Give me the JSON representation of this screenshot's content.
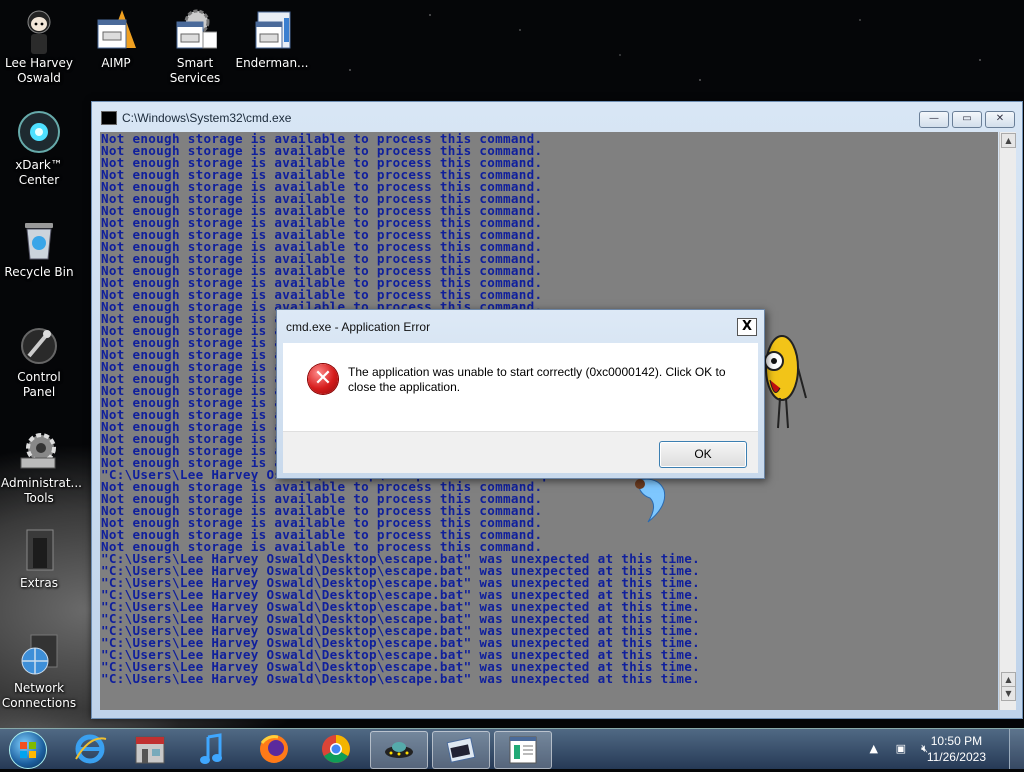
{
  "desktop": {
    "icons": [
      {
        "label": "Lee Harvey Oswald"
      },
      {
        "label": "AIMP"
      },
      {
        "label": "Smart Services"
      },
      {
        "label": "Enderman..."
      },
      {
        "label": "xDark™ Center"
      },
      {
        "label": "Recycle Bin"
      },
      {
        "label": "Control Panel"
      },
      {
        "label": "Administrat... Tools"
      },
      {
        "label": "Extras"
      },
      {
        "label": "Network Connections"
      }
    ]
  },
  "cmd_window": {
    "title": "C:\\Windows\\System32\\cmd.exe",
    "minimize_label": "—",
    "maximize_label": "▭",
    "close_label": "✕",
    "console_lines": [
      "Not enough storage is available to process this command.",
      "Not enough storage is available to process this command.",
      "Not enough storage is available to process this command.",
      "Not enough storage is available to process this command.",
      "Not enough storage is available to process this command.",
      "Not enough storage is available to process this command.",
      "Not enough storage is available to process this command.",
      "Not enough storage is available to process this command.",
      "Not enough storage is available to process this command.",
      "Not enough storage is available to process this command.",
      "Not enough storage is available to process this command.",
      "Not enough storage is available to process this command.",
      "Not enough storage is available to process this command.",
      "Not enough storage is available to process this command.",
      "Not enough storage is available to process this command.",
      "Not enough storage is available to process this command.",
      "Not enough storage is available to process this command.",
      "Not enough storage is available to process this command.",
      "Not enough storage is available to process this command.",
      "Not enough storage is available to process this command.",
      "Not enough storage is available to process this command.",
      "Not enough storage is available to process this command.",
      "Not enough storage is available to process this command.",
      "Not enough storage is available to process this command.",
      "Not enough storage is available to process this command.",
      "Not enough storage is available to process this command.",
      "Not enough storage is available to process this command.",
      "Not enough storage is available to process this command.",
      "\"C:\\Users\\Lee Harvey Oswald\\Desktop\\escape.bat\" was unexpected at this time.",
      "Not enough storage is available to process this command.",
      "Not enough storage is available to process this command.",
      "Not enough storage is available to process this command.",
      "Not enough storage is available to process this command.",
      "Not enough storage is available to process this command.",
      "Not enough storage is available to process this command.",
      "\"C:\\Users\\Lee Harvey Oswald\\Desktop\\escape.bat\" was unexpected at this time.",
      "\"C:\\Users\\Lee Harvey Oswald\\Desktop\\escape.bat\" was unexpected at this time.",
      "\"C:\\Users\\Lee Harvey Oswald\\Desktop\\escape.bat\" was unexpected at this time.",
      "\"C:\\Users\\Lee Harvey Oswald\\Desktop\\escape.bat\" was unexpected at this time.",
      "\"C:\\Users\\Lee Harvey Oswald\\Desktop\\escape.bat\" was unexpected at this time.",
      "\"C:\\Users\\Lee Harvey Oswald\\Desktop\\escape.bat\" was unexpected at this time.",
      "\"C:\\Users\\Lee Harvey Oswald\\Desktop\\escape.bat\" was unexpected at this time.",
      "\"C:\\Users\\Lee Harvey Oswald\\Desktop\\escape.bat\" was unexpected at this time.",
      "\"C:\\Users\\Lee Harvey Oswald\\Desktop\\escape.bat\" was unexpected at this time.",
      "\"C:\\Users\\Lee Harvey Oswald\\Desktop\\escape.bat\" was unexpected at this time.",
      "\"C:\\Users\\Lee Harvey Oswald\\Desktop\\escape.bat\" was unexpected at this time."
    ],
    "console_color": "#0f1f9c",
    "console_background": "#808080"
  },
  "error_dialog": {
    "title": "cmd.exe - Application Error",
    "close_label": "X",
    "message": "The application was unable to start correctly (0xc0000142). Click OK to close the application.",
    "ok_label": "OK",
    "icon": "error-icon"
  },
  "taskbar": {
    "items": [
      "start-orb",
      "internet-explorer-icon",
      "store-icon",
      "music-icon",
      "firefox-icon",
      "chrome-icon",
      "ufo-app-icon",
      "cmd-task-icon",
      "notepad-icon"
    ],
    "clock_time": "10:50 PM",
    "clock_date": "11/26/2023"
  }
}
